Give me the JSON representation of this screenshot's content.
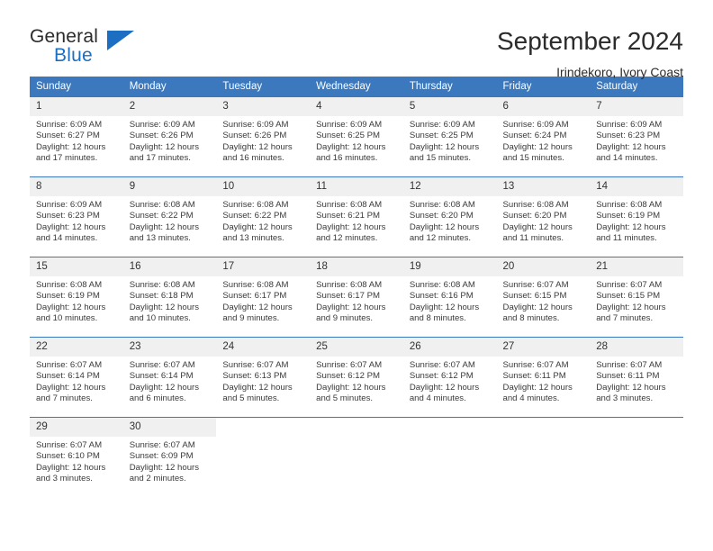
{
  "logo": {
    "primary": "General",
    "secondary": "Blue",
    "mark": "triangle-icon"
  },
  "header": {
    "title": "September 2024",
    "subtitle": "Irindekoro, Ivory Coast"
  },
  "colors": {
    "header_blue": "#3b78bd",
    "logo_blue": "#1b6ec2",
    "daynum_band": "#f0f0f0",
    "text": "#2b2b2b"
  },
  "weekday_headers": [
    "Sunday",
    "Monday",
    "Tuesday",
    "Wednesday",
    "Thursday",
    "Friday",
    "Saturday"
  ],
  "weeks": [
    [
      {
        "day": "1",
        "sunrise": "Sunrise: 6:09 AM",
        "sunset": "Sunset: 6:27 PM",
        "daylight1": "Daylight: 12 hours",
        "daylight2": "and 17 minutes."
      },
      {
        "day": "2",
        "sunrise": "Sunrise: 6:09 AM",
        "sunset": "Sunset: 6:26 PM",
        "daylight1": "Daylight: 12 hours",
        "daylight2": "and 17 minutes."
      },
      {
        "day": "3",
        "sunrise": "Sunrise: 6:09 AM",
        "sunset": "Sunset: 6:26 PM",
        "daylight1": "Daylight: 12 hours",
        "daylight2": "and 16 minutes."
      },
      {
        "day": "4",
        "sunrise": "Sunrise: 6:09 AM",
        "sunset": "Sunset: 6:25 PM",
        "daylight1": "Daylight: 12 hours",
        "daylight2": "and 16 minutes."
      },
      {
        "day": "5",
        "sunrise": "Sunrise: 6:09 AM",
        "sunset": "Sunset: 6:25 PM",
        "daylight1": "Daylight: 12 hours",
        "daylight2": "and 15 minutes."
      },
      {
        "day": "6",
        "sunrise": "Sunrise: 6:09 AM",
        "sunset": "Sunset: 6:24 PM",
        "daylight1": "Daylight: 12 hours",
        "daylight2": "and 15 minutes."
      },
      {
        "day": "7",
        "sunrise": "Sunrise: 6:09 AM",
        "sunset": "Sunset: 6:23 PM",
        "daylight1": "Daylight: 12 hours",
        "daylight2": "and 14 minutes."
      }
    ],
    [
      {
        "day": "8",
        "sunrise": "Sunrise: 6:09 AM",
        "sunset": "Sunset: 6:23 PM",
        "daylight1": "Daylight: 12 hours",
        "daylight2": "and 14 minutes."
      },
      {
        "day": "9",
        "sunrise": "Sunrise: 6:08 AM",
        "sunset": "Sunset: 6:22 PM",
        "daylight1": "Daylight: 12 hours",
        "daylight2": "and 13 minutes."
      },
      {
        "day": "10",
        "sunrise": "Sunrise: 6:08 AM",
        "sunset": "Sunset: 6:22 PM",
        "daylight1": "Daylight: 12 hours",
        "daylight2": "and 13 minutes."
      },
      {
        "day": "11",
        "sunrise": "Sunrise: 6:08 AM",
        "sunset": "Sunset: 6:21 PM",
        "daylight1": "Daylight: 12 hours",
        "daylight2": "and 12 minutes."
      },
      {
        "day": "12",
        "sunrise": "Sunrise: 6:08 AM",
        "sunset": "Sunset: 6:20 PM",
        "daylight1": "Daylight: 12 hours",
        "daylight2": "and 12 minutes."
      },
      {
        "day": "13",
        "sunrise": "Sunrise: 6:08 AM",
        "sunset": "Sunset: 6:20 PM",
        "daylight1": "Daylight: 12 hours",
        "daylight2": "and 11 minutes."
      },
      {
        "day": "14",
        "sunrise": "Sunrise: 6:08 AM",
        "sunset": "Sunset: 6:19 PM",
        "daylight1": "Daylight: 12 hours",
        "daylight2": "and 11 minutes."
      }
    ],
    [
      {
        "day": "15",
        "sunrise": "Sunrise: 6:08 AM",
        "sunset": "Sunset: 6:19 PM",
        "daylight1": "Daylight: 12 hours",
        "daylight2": "and 10 minutes."
      },
      {
        "day": "16",
        "sunrise": "Sunrise: 6:08 AM",
        "sunset": "Sunset: 6:18 PM",
        "daylight1": "Daylight: 12 hours",
        "daylight2": "and 10 minutes."
      },
      {
        "day": "17",
        "sunrise": "Sunrise: 6:08 AM",
        "sunset": "Sunset: 6:17 PM",
        "daylight1": "Daylight: 12 hours",
        "daylight2": "and 9 minutes."
      },
      {
        "day": "18",
        "sunrise": "Sunrise: 6:08 AM",
        "sunset": "Sunset: 6:17 PM",
        "daylight1": "Daylight: 12 hours",
        "daylight2": "and 9 minutes."
      },
      {
        "day": "19",
        "sunrise": "Sunrise: 6:08 AM",
        "sunset": "Sunset: 6:16 PM",
        "daylight1": "Daylight: 12 hours",
        "daylight2": "and 8 minutes."
      },
      {
        "day": "20",
        "sunrise": "Sunrise: 6:07 AM",
        "sunset": "Sunset: 6:15 PM",
        "daylight1": "Daylight: 12 hours",
        "daylight2": "and 8 minutes."
      },
      {
        "day": "21",
        "sunrise": "Sunrise: 6:07 AM",
        "sunset": "Sunset: 6:15 PM",
        "daylight1": "Daylight: 12 hours",
        "daylight2": "and 7 minutes."
      }
    ],
    [
      {
        "day": "22",
        "sunrise": "Sunrise: 6:07 AM",
        "sunset": "Sunset: 6:14 PM",
        "daylight1": "Daylight: 12 hours",
        "daylight2": "and 7 minutes."
      },
      {
        "day": "23",
        "sunrise": "Sunrise: 6:07 AM",
        "sunset": "Sunset: 6:14 PM",
        "daylight1": "Daylight: 12 hours",
        "daylight2": "and 6 minutes."
      },
      {
        "day": "24",
        "sunrise": "Sunrise: 6:07 AM",
        "sunset": "Sunset: 6:13 PM",
        "daylight1": "Daylight: 12 hours",
        "daylight2": "and 5 minutes."
      },
      {
        "day": "25",
        "sunrise": "Sunrise: 6:07 AM",
        "sunset": "Sunset: 6:12 PM",
        "daylight1": "Daylight: 12 hours",
        "daylight2": "and 5 minutes."
      },
      {
        "day": "26",
        "sunrise": "Sunrise: 6:07 AM",
        "sunset": "Sunset: 6:12 PM",
        "daylight1": "Daylight: 12 hours",
        "daylight2": "and 4 minutes."
      },
      {
        "day": "27",
        "sunrise": "Sunrise: 6:07 AM",
        "sunset": "Sunset: 6:11 PM",
        "daylight1": "Daylight: 12 hours",
        "daylight2": "and 4 minutes."
      },
      {
        "day": "28",
        "sunrise": "Sunrise: 6:07 AM",
        "sunset": "Sunset: 6:11 PM",
        "daylight1": "Daylight: 12 hours",
        "daylight2": "and 3 minutes."
      }
    ],
    [
      {
        "day": "29",
        "sunrise": "Sunrise: 6:07 AM",
        "sunset": "Sunset: 6:10 PM",
        "daylight1": "Daylight: 12 hours",
        "daylight2": "and 3 minutes."
      },
      {
        "day": "30",
        "sunrise": "Sunrise: 6:07 AM",
        "sunset": "Sunset: 6:09 PM",
        "daylight1": "Daylight: 12 hours",
        "daylight2": "and 2 minutes."
      },
      {
        "day": "",
        "sunrise": "",
        "sunset": "",
        "daylight1": "",
        "daylight2": ""
      },
      {
        "day": "",
        "sunrise": "",
        "sunset": "",
        "daylight1": "",
        "daylight2": ""
      },
      {
        "day": "",
        "sunrise": "",
        "sunset": "",
        "daylight1": "",
        "daylight2": ""
      },
      {
        "day": "",
        "sunrise": "",
        "sunset": "",
        "daylight1": "",
        "daylight2": ""
      },
      {
        "day": "",
        "sunrise": "",
        "sunset": "",
        "daylight1": "",
        "daylight2": ""
      }
    ]
  ]
}
